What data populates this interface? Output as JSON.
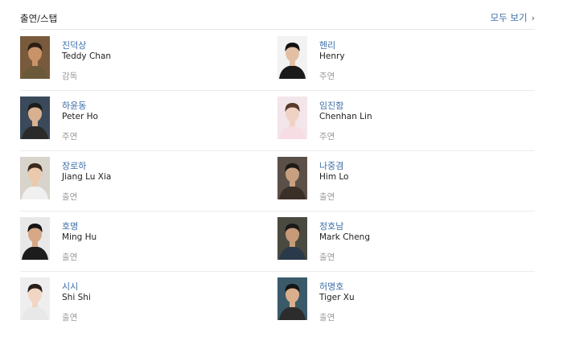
{
  "section": {
    "title": "출연/스탭",
    "more_label": "모두 보기"
  },
  "cast": [
    {
      "korean_name": "진덕상",
      "english_name": "Teddy Chan",
      "role": "감독",
      "photo": {
        "bg": "#7a5a3c",
        "skin": "#c9936a",
        "hair": "#2c1f14",
        "shirt": "#6b5a3a"
      }
    },
    {
      "korean_name": "헨리",
      "english_name": "Henry",
      "role": "주연",
      "photo": {
        "bg": "#f2f2f2",
        "skin": "#e3c0a4",
        "hair": "#111111",
        "shirt": "#1a1a1a"
      }
    },
    {
      "korean_name": "하윤동",
      "english_name": "Peter Ho",
      "role": "주연",
      "photo": {
        "bg": "#3a4a5a",
        "skin": "#d8b190",
        "hair": "#1c1c1c",
        "shirt": "#2a2a2a"
      }
    },
    {
      "korean_name": "임진함",
      "english_name": "Chenhan Lin",
      "role": "주연",
      "photo": {
        "bg": "#f3e6ea",
        "skin": "#f0d2c4",
        "hair": "#5a3a2a",
        "shirt": "#f6dde3"
      }
    },
    {
      "korean_name": "장로하",
      "english_name": "Jiang Lu Xia",
      "role": "출연",
      "photo": {
        "bg": "#d8d4cc",
        "skin": "#eac9ad",
        "hair": "#3b2a1c",
        "shirt": "#f0f0f0"
      }
    },
    {
      "korean_name": "나중겸",
      "english_name": "Him Lo",
      "role": "출연",
      "photo": {
        "bg": "#5a5048",
        "skin": "#c8a080",
        "hair": "#1e1a16",
        "shirt": "#3a3028"
      }
    },
    {
      "korean_name": "호명",
      "english_name": "Ming Hu",
      "role": "출연",
      "photo": {
        "bg": "#e8e8e8",
        "skin": "#d6a886",
        "hair": "#151515",
        "shirt": "#1c1c1c"
      }
    },
    {
      "korean_name": "정호남",
      "english_name": "Mark Cheng",
      "role": "출연",
      "photo": {
        "bg": "#4a4a40",
        "skin": "#c79a78",
        "hair": "#1a1a1a",
        "shirt": "#2a3a4a"
      }
    },
    {
      "korean_name": "시시",
      "english_name": "Shi Shi",
      "role": "출연",
      "photo": {
        "bg": "#eeeeee",
        "skin": "#f2d6c4",
        "hair": "#2a1e1a",
        "shirt": "#e8e8e8"
      }
    },
    {
      "korean_name": "허명호",
      "english_name": "Tiger Xu",
      "role": "출연",
      "photo": {
        "bg": "#3a5a6a",
        "skin": "#d9ae8c",
        "hair": "#151515",
        "shirt": "#2c2c2c"
      }
    }
  ]
}
